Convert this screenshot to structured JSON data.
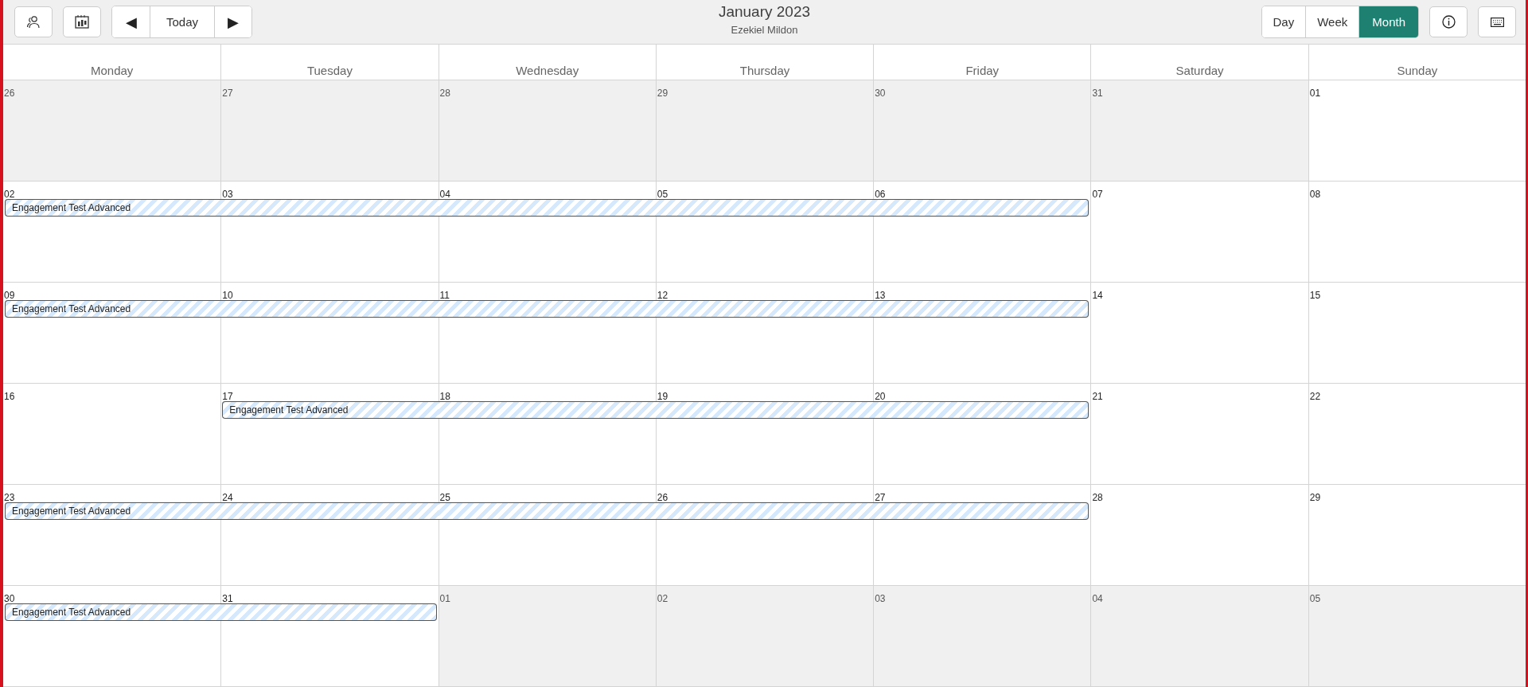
{
  "toolbar": {
    "left_buttons": [
      {
        "kind": "people"
      },
      {
        "kind": "calendar"
      }
    ],
    "nav": {
      "prev": "◀",
      "today": "Today",
      "next": "▶"
    },
    "title": "January 2023",
    "subtitle": "Ezekiel Mildon",
    "views": [
      {
        "label": "Day",
        "selected": false
      },
      {
        "label": "Week",
        "selected": false
      },
      {
        "label": "Month",
        "selected": true
      }
    ],
    "right_buttons": [
      {
        "kind": "info"
      },
      {
        "kind": "keyboard"
      }
    ]
  },
  "weekdays": [
    "Monday",
    "Tuesday",
    "Wednesday",
    "Thursday",
    "Friday",
    "Saturday",
    "Sunday"
  ],
  "weeks": [
    {
      "days": [
        {
          "date": "26",
          "outside_month": true
        },
        {
          "date": "27",
          "outside_month": true
        },
        {
          "date": "28",
          "outside_month": true
        },
        {
          "date": "29",
          "outside_month": true
        },
        {
          "date": "30",
          "outside_month": true
        },
        {
          "date": "31",
          "outside_month": true
        },
        {
          "date": "01",
          "outside_month": false
        }
      ]
    },
    {
      "event_title": "Engagement Test Advanced",
      "days": [
        {
          "date": "02",
          "outside_month": false,
          "in_event": true
        },
        {
          "date": "03",
          "outside_month": false,
          "in_event": true
        },
        {
          "date": "04",
          "outside_month": false,
          "in_event": true
        },
        {
          "date": "05",
          "outside_month": false,
          "in_event": true
        },
        {
          "date": "06",
          "outside_month": false,
          "in_event": true
        },
        {
          "date": "07",
          "outside_month": false,
          "in_event": false
        },
        {
          "date": "08",
          "outside_month": false,
          "in_event": false
        }
      ]
    },
    {
      "event_title": "Engagement Test Advanced",
      "days": [
        {
          "date": "09",
          "outside_month": false,
          "in_event": true
        },
        {
          "date": "10",
          "outside_month": false,
          "in_event": true
        },
        {
          "date": "11",
          "outside_month": false,
          "in_event": true
        },
        {
          "date": "12",
          "outside_month": false,
          "in_event": true
        },
        {
          "date": "13",
          "outside_month": false,
          "in_event": true
        },
        {
          "date": "14",
          "outside_month": false,
          "in_event": false
        },
        {
          "date": "15",
          "outside_month": false,
          "in_event": false
        }
      ]
    },
    {
      "event_title": "Engagement Test Advanced",
      "days": [
        {
          "date": "16",
          "outside_month": false,
          "in_event": false
        },
        {
          "date": "17",
          "outside_month": false,
          "in_event": true
        },
        {
          "date": "18",
          "outside_month": false,
          "in_event": true
        },
        {
          "date": "19",
          "outside_month": false,
          "in_event": true
        },
        {
          "date": "20",
          "outside_month": false,
          "in_event": true
        },
        {
          "date": "21",
          "outside_month": false,
          "in_event": false
        },
        {
          "date": "22",
          "outside_month": false,
          "in_event": false
        }
      ]
    },
    {
      "event_title": "Engagement Test Advanced",
      "days": [
        {
          "date": "23",
          "outside_month": false,
          "in_event": true
        },
        {
          "date": "24",
          "outside_month": false,
          "in_event": true
        },
        {
          "date": "25",
          "outside_month": false,
          "in_event": true
        },
        {
          "date": "26",
          "outside_month": false,
          "in_event": true
        },
        {
          "date": "27",
          "outside_month": false,
          "in_event": true
        },
        {
          "date": "28",
          "outside_month": false,
          "in_event": false
        },
        {
          "date": "29",
          "outside_month": false,
          "in_event": false
        }
      ]
    },
    {
      "event_title": "Engagement Test Advanced",
      "days": [
        {
          "date": "30",
          "outside_month": false,
          "in_event": true
        },
        {
          "date": "31",
          "outside_month": false,
          "in_event": true
        },
        {
          "date": "01",
          "outside_month": true,
          "in_event": false
        },
        {
          "date": "02",
          "outside_month": true,
          "in_event": false
        },
        {
          "date": "03",
          "outside_month": true,
          "in_event": false
        },
        {
          "date": "04",
          "outside_month": true,
          "in_event": false
        },
        {
          "date": "05",
          "outside_month": true,
          "in_event": false
        }
      ]
    }
  ]
}
